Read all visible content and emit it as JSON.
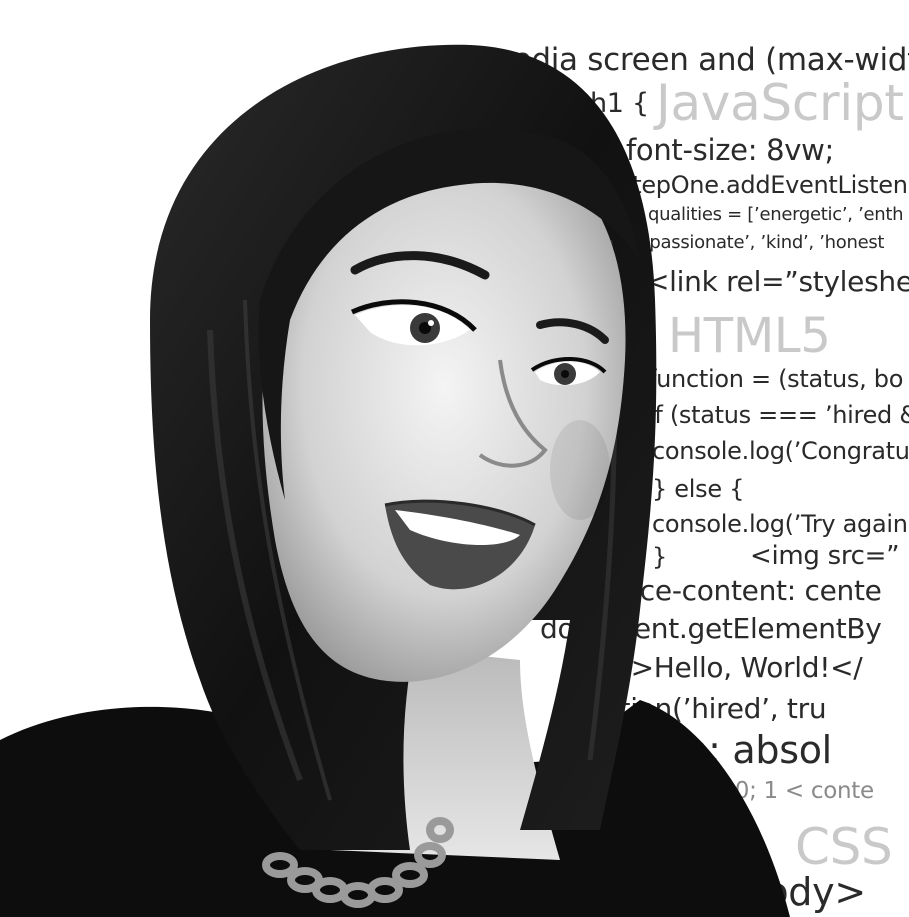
{
  "code_lines": [
    "@media screen and (max-width",
    "h1 {",
    "JavaScript",
    "font-size: 8vw;",
    "stepOne.addEventListene",
    "qualities = [’energetic’, ’enth",
    "’passionate’, ’kind’, ’honest",
    "<link rel=”styleshee",
    "HTML5",
    "function = (status, bo",
    "if (status === ’hired &",
    "console.log(’Congratu",
    "} else {",
    "console.log(’Try again",
    "}",
    "<img src=”",
    "place-content: cente",
    "document.getElementBy",
    "<p>Hello, World!</",
    "function(’hired’, tru",
    "position: absol",
    "let i = 0; 1 < conte",
    "CSS",
    "<body>"
  ],
  "colors": {
    "background": "#ffffff",
    "code_text": "#2a2a2a",
    "watermark_text": "#c9c9c9",
    "hair": "#141414",
    "jacket": "#0d0d0d"
  }
}
